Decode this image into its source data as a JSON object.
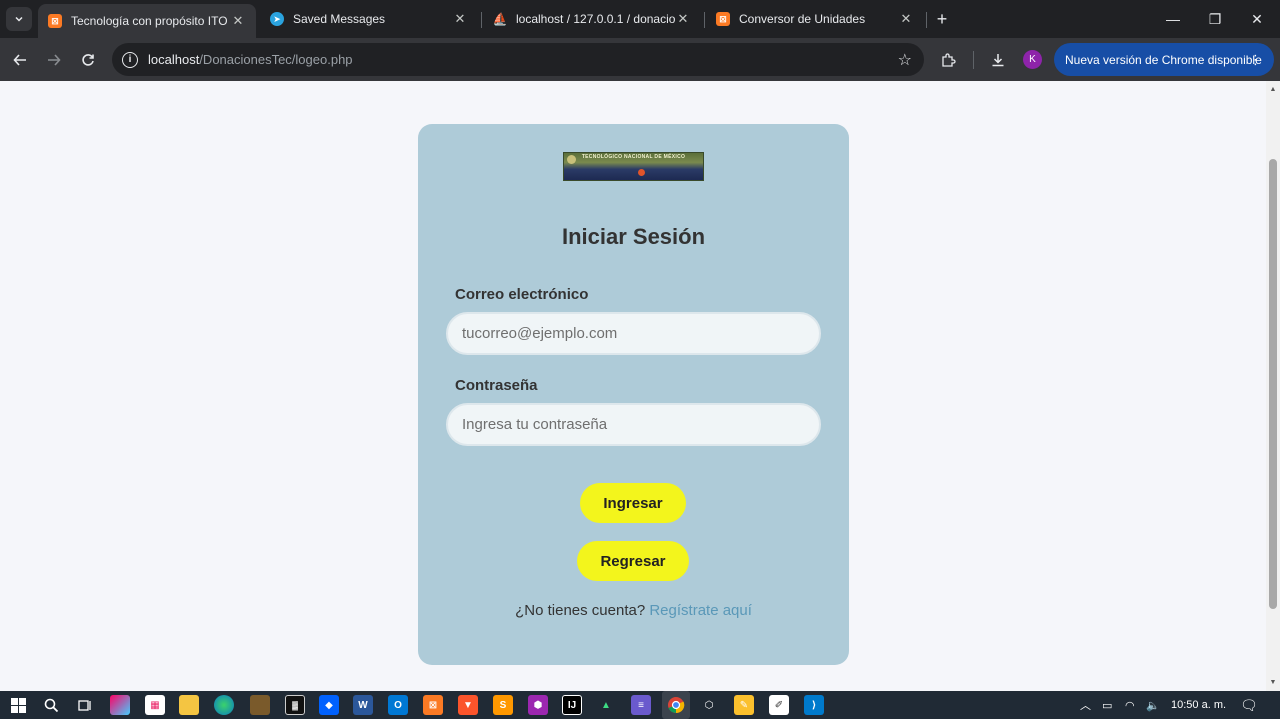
{
  "browser": {
    "tabs": [
      {
        "title": "Tecnología con propósito ITO",
        "active": true,
        "icon": "xampp-icon"
      },
      {
        "title": "Saved Messages",
        "active": false,
        "icon": "telegram-icon"
      },
      {
        "title": "localhost / 127.0.0.1 / donacion",
        "active": false,
        "icon": "phpmyadmin-icon"
      },
      {
        "title": "Conversor de Unidades",
        "active": false,
        "icon": "xampp-icon"
      }
    ],
    "url_host": "localhost",
    "url_path": "/DonacionesTec/logeo.php",
    "profile_initial": "K",
    "update_label": "Nueva versión de Chrome disponible"
  },
  "logo": {
    "text": "TECNOLÓGICO NACIONAL DE MÉXICO"
  },
  "login": {
    "heading": "Iniciar Sesión",
    "email_label": "Correo electrónico",
    "email_placeholder": "tucorreo@ejemplo.com",
    "password_label": "Contraseña",
    "password_placeholder": "Ingresa tu contraseña",
    "submit_label": "Ingresar",
    "back_label": "Regresar",
    "footer_text": "¿No tienes cuenta?",
    "register_link": "Regístrate aquí"
  },
  "taskbar": {
    "clock": "10:50 a. m."
  },
  "colors": {
    "card_bg": "#aecbd8",
    "button_bg": "#f3f51c",
    "link": "#5a98b8",
    "page_bg": "#f5f6fa"
  }
}
